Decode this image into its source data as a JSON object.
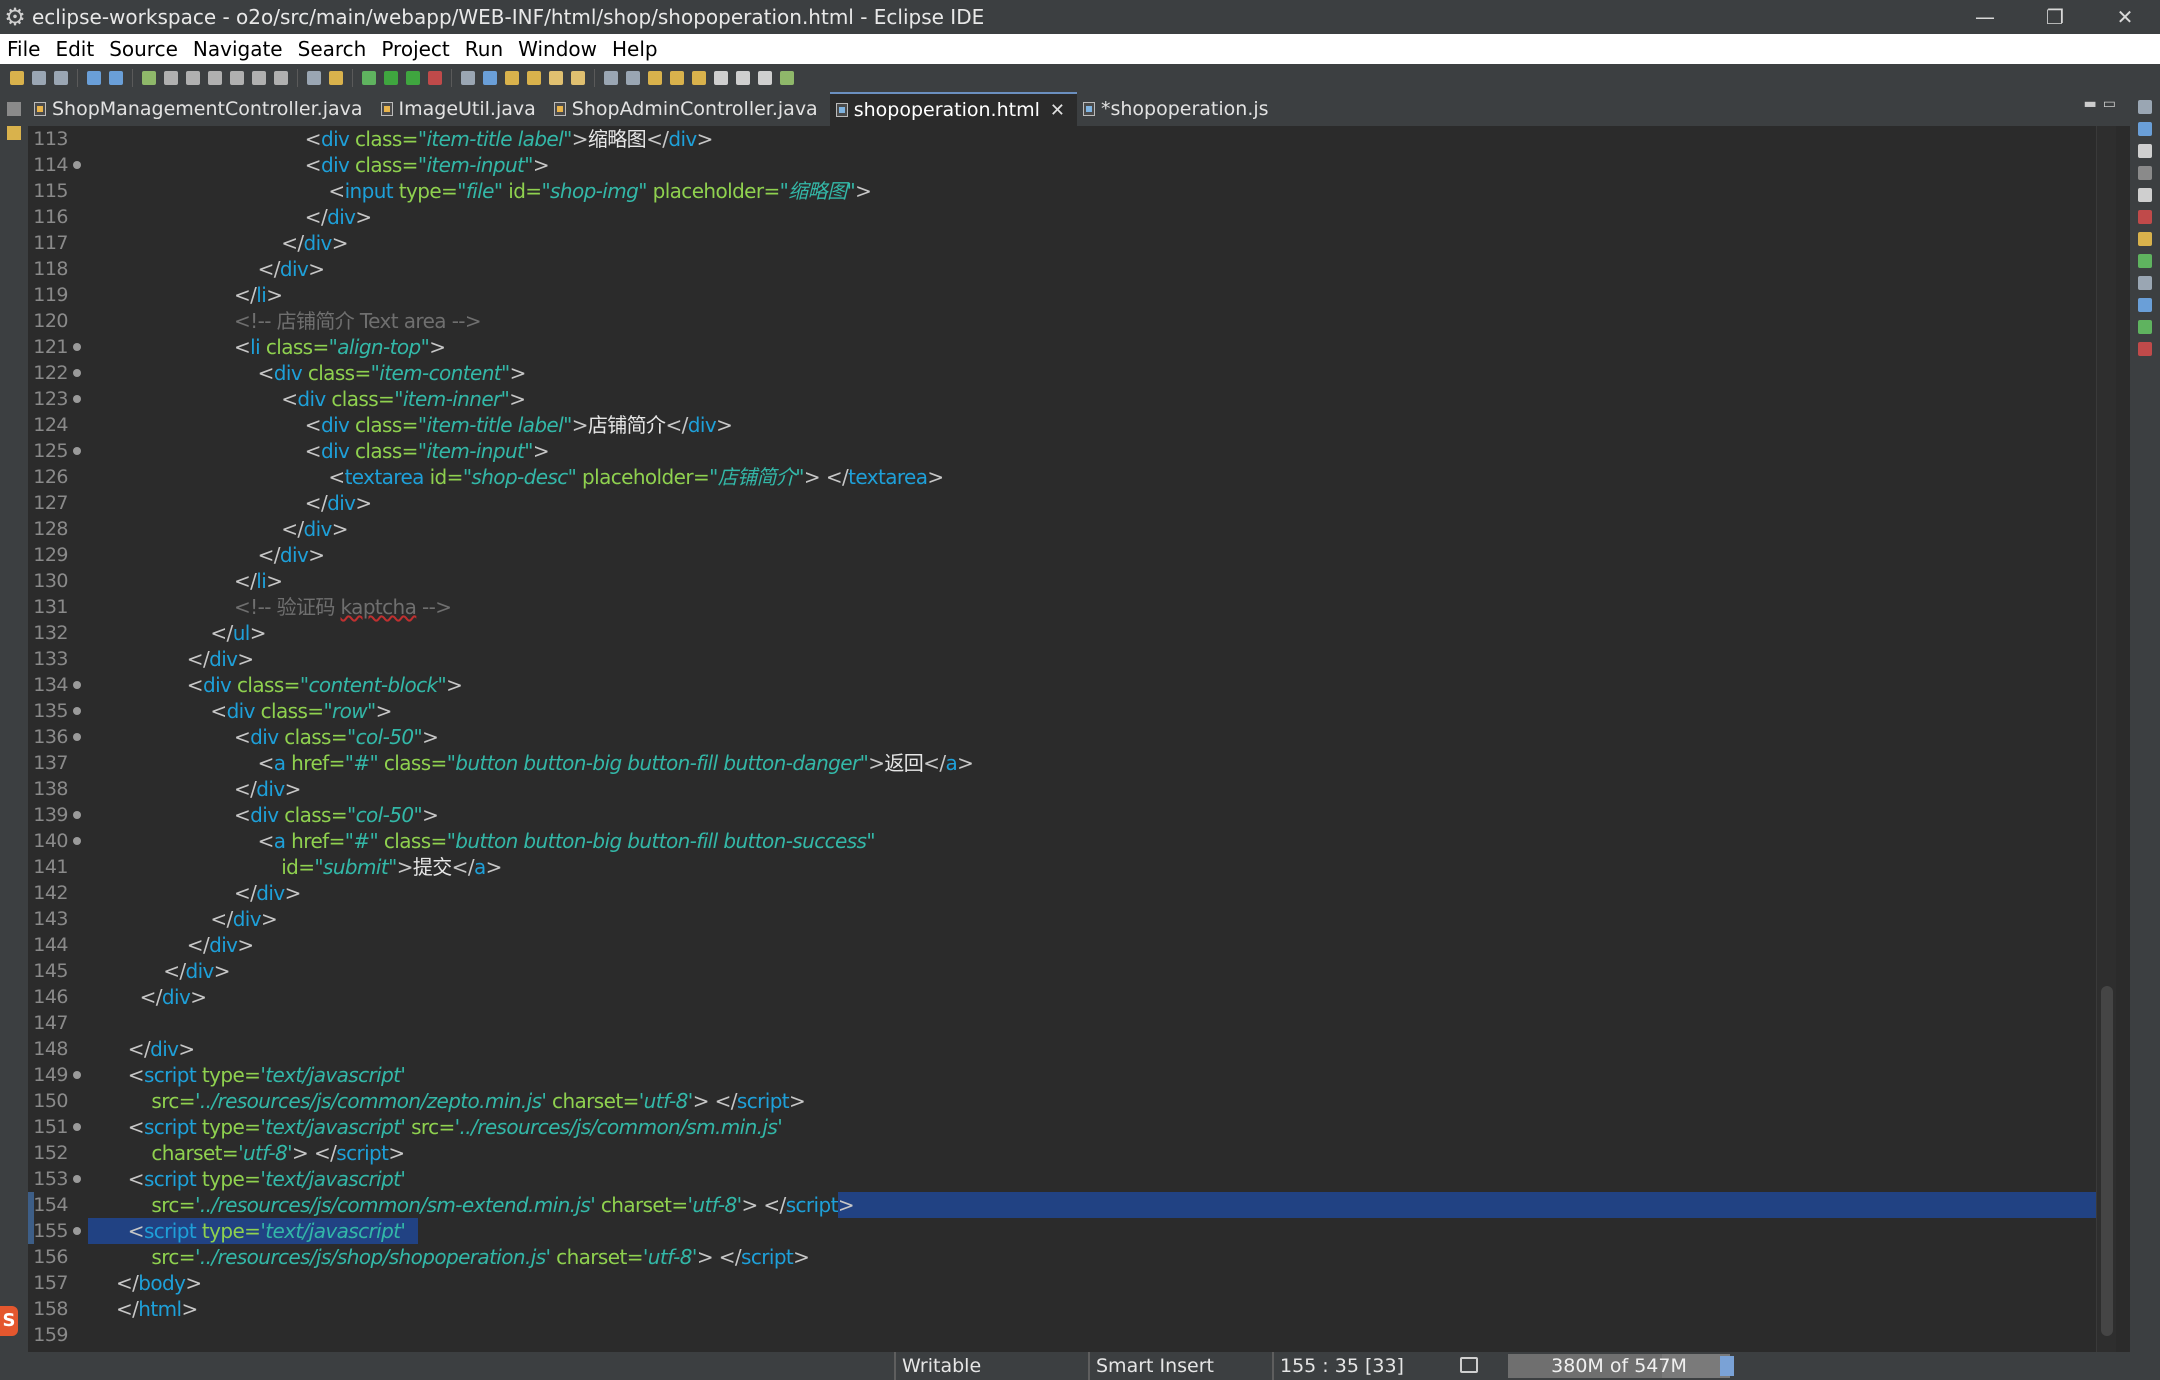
{
  "window": {
    "title": "eclipse-workspace - o2o/src/main/webapp/WEB-INF/html/shop/shopoperation.html - Eclipse IDE",
    "controls": {
      "minimize": "—",
      "restore": "❐",
      "close": "✕"
    }
  },
  "menu": [
    "File",
    "Edit",
    "Source",
    "Navigate",
    "Search",
    "Project",
    "Run",
    "Window",
    "Help"
  ],
  "tabs": [
    {
      "label": "ShopManagementController.java",
      "kind": "j",
      "active": false
    },
    {
      "label": "ImageUtil.java",
      "kind": "j",
      "active": false
    },
    {
      "label": "ShopAdminController.java",
      "kind": "j",
      "active": false
    },
    {
      "label": "shopoperation.html",
      "kind": "h",
      "active": true,
      "close": "✕"
    },
    {
      "label": "*shopoperation.js",
      "kind": "h",
      "active": false
    }
  ],
  "colors": {
    "selection": "#214283",
    "tag": "#1ea0d9",
    "attr": "#8fd14f",
    "value": "#33b8a8",
    "comment": "#6f6f6f"
  },
  "lines": [
    {
      "n": "113",
      "f": false,
      "i": 16,
      "t": [
        [
          "br",
          "<"
        ],
        [
          "tag",
          "div"
        ],
        [
          "at",
          " class="
        ],
        [
          "val",
          "\"item-title label\""
        ],
        [
          "br",
          ">"
        ],
        [
          "txt",
          "缩略图"
        ],
        [
          "br",
          "</"
        ],
        [
          "tag",
          "div"
        ],
        [
          "br",
          ">"
        ]
      ]
    },
    {
      "n": "114",
      "f": true,
      "i": 16,
      "t": [
        [
          "br",
          "<"
        ],
        [
          "tag",
          "div"
        ],
        [
          "at",
          " class="
        ],
        [
          "val",
          "\"item-input\""
        ],
        [
          "br",
          ">"
        ]
      ]
    },
    {
      "n": "115",
      "f": false,
      "i": 18,
      "t": [
        [
          "br",
          "<"
        ],
        [
          "tag",
          "input"
        ],
        [
          "at",
          " type="
        ],
        [
          "val",
          "\"file\""
        ],
        [
          "at",
          " id="
        ],
        [
          "val",
          "\"shop-img\""
        ],
        [
          "at",
          " placeholder="
        ],
        [
          "val",
          "\"缩略图\""
        ],
        [
          "br",
          ">"
        ]
      ]
    },
    {
      "n": "116",
      "f": false,
      "i": 16,
      "t": [
        [
          "br",
          "</"
        ],
        [
          "tag",
          "div"
        ],
        [
          "br",
          ">"
        ]
      ]
    },
    {
      "n": "117",
      "f": false,
      "i": 14,
      "t": [
        [
          "br",
          "</"
        ],
        [
          "tag",
          "div"
        ],
        [
          "br",
          ">"
        ]
      ]
    },
    {
      "n": "118",
      "f": false,
      "i": 12,
      "t": [
        [
          "br",
          "</"
        ],
        [
          "tag",
          "div"
        ],
        [
          "br",
          ">"
        ]
      ]
    },
    {
      "n": "119",
      "f": false,
      "i": 10,
      "t": [
        [
          "br",
          "</"
        ],
        [
          "tag",
          "li"
        ],
        [
          "br",
          ">"
        ]
      ]
    },
    {
      "n": "120",
      "f": false,
      "i": 10,
      "t": [
        [
          "cm",
          "<!-- 店铺简介 Text area -->"
        ]
      ]
    },
    {
      "n": "121",
      "f": true,
      "i": 10,
      "t": [
        [
          "br",
          "<"
        ],
        [
          "tag",
          "li"
        ],
        [
          "at",
          " class="
        ],
        [
          "val",
          "\"align-top\""
        ],
        [
          "br",
          ">"
        ]
      ]
    },
    {
      "n": "122",
      "f": true,
      "i": 12,
      "t": [
        [
          "br",
          "<"
        ],
        [
          "tag",
          "div"
        ],
        [
          "at",
          " class="
        ],
        [
          "val",
          "\"item-content\""
        ],
        [
          "br",
          ">"
        ]
      ]
    },
    {
      "n": "123",
      "f": true,
      "i": 14,
      "t": [
        [
          "br",
          "<"
        ],
        [
          "tag",
          "div"
        ],
        [
          "at",
          " class="
        ],
        [
          "val",
          "\"item-inner\""
        ],
        [
          "br",
          ">"
        ]
      ]
    },
    {
      "n": "124",
      "f": false,
      "i": 16,
      "t": [
        [
          "br",
          "<"
        ],
        [
          "tag",
          "div"
        ],
        [
          "at",
          " class="
        ],
        [
          "val",
          "\"item-title label\""
        ],
        [
          "br",
          ">"
        ],
        [
          "txt",
          "店铺简介"
        ],
        [
          "br",
          "</"
        ],
        [
          "tag",
          "div"
        ],
        [
          "br",
          ">"
        ]
      ]
    },
    {
      "n": "125",
      "f": true,
      "i": 16,
      "t": [
        [
          "br",
          "<"
        ],
        [
          "tag",
          "div"
        ],
        [
          "at",
          " class="
        ],
        [
          "val",
          "\"item-input\""
        ],
        [
          "br",
          ">"
        ]
      ]
    },
    {
      "n": "126",
      "f": false,
      "i": 18,
      "t": [
        [
          "br",
          "<"
        ],
        [
          "tag",
          "textarea"
        ],
        [
          "at",
          " id="
        ],
        [
          "val",
          "\"shop-desc\""
        ],
        [
          "at",
          " placeholder="
        ],
        [
          "val",
          "\"店铺简介\""
        ],
        [
          "br",
          "> </"
        ],
        [
          "tag",
          "textarea"
        ],
        [
          "br",
          ">"
        ]
      ]
    },
    {
      "n": "127",
      "f": false,
      "i": 16,
      "t": [
        [
          "br",
          "</"
        ],
        [
          "tag",
          "div"
        ],
        [
          "br",
          ">"
        ]
      ]
    },
    {
      "n": "128",
      "f": false,
      "i": 14,
      "t": [
        [
          "br",
          "</"
        ],
        [
          "tag",
          "div"
        ],
        [
          "br",
          ">"
        ]
      ]
    },
    {
      "n": "129",
      "f": false,
      "i": 12,
      "t": [
        [
          "br",
          "</"
        ],
        [
          "tag",
          "div"
        ],
        [
          "br",
          ">"
        ]
      ]
    },
    {
      "n": "130",
      "f": false,
      "i": 10,
      "t": [
        [
          "br",
          "</"
        ],
        [
          "tag",
          "li"
        ],
        [
          "br",
          ">"
        ]
      ]
    },
    {
      "n": "131",
      "f": false,
      "i": 10,
      "t": [
        [
          "cm",
          "<!-- 验证码 "
        ],
        [
          "cmu",
          "kaptcha"
        ],
        [
          "cm",
          " -->"
        ]
      ]
    },
    {
      "n": "132",
      "f": false,
      "i": 8,
      "t": [
        [
          "br",
          "</"
        ],
        [
          "tag",
          "ul"
        ],
        [
          "br",
          ">"
        ]
      ]
    },
    {
      "n": "133",
      "f": false,
      "i": 6,
      "t": [
        [
          "br",
          "</"
        ],
        [
          "tag",
          "div"
        ],
        [
          "br",
          ">"
        ]
      ]
    },
    {
      "n": "134",
      "f": true,
      "i": 6,
      "t": [
        [
          "br",
          "<"
        ],
        [
          "tag",
          "div"
        ],
        [
          "at",
          " class="
        ],
        [
          "val",
          "\"content-block\""
        ],
        [
          "br",
          ">"
        ]
      ]
    },
    {
      "n": "135",
      "f": true,
      "i": 8,
      "t": [
        [
          "br",
          "<"
        ],
        [
          "tag",
          "div"
        ],
        [
          "at",
          " class="
        ],
        [
          "val",
          "\"row\""
        ],
        [
          "br",
          ">"
        ]
      ]
    },
    {
      "n": "136",
      "f": true,
      "i": 10,
      "t": [
        [
          "br",
          "<"
        ],
        [
          "tag",
          "div"
        ],
        [
          "at",
          " class="
        ],
        [
          "val",
          "\"col-50\""
        ],
        [
          "br",
          ">"
        ]
      ]
    },
    {
      "n": "137",
      "f": false,
      "i": 12,
      "t": [
        [
          "br",
          "<"
        ],
        [
          "tag",
          "a"
        ],
        [
          "at",
          " href="
        ],
        [
          "val",
          "\"#\""
        ],
        [
          "at",
          " class="
        ],
        [
          "val",
          "\"button button-big button-fill button-danger\""
        ],
        [
          "br",
          ">"
        ],
        [
          "txt",
          "返回"
        ],
        [
          "br",
          "</"
        ],
        [
          "tag",
          "a"
        ],
        [
          "br",
          ">"
        ]
      ]
    },
    {
      "n": "138",
      "f": false,
      "i": 10,
      "t": [
        [
          "br",
          "</"
        ],
        [
          "tag",
          "div"
        ],
        [
          "br",
          ">"
        ]
      ]
    },
    {
      "n": "139",
      "f": true,
      "i": 10,
      "t": [
        [
          "br",
          "<"
        ],
        [
          "tag",
          "div"
        ],
        [
          "at",
          " class="
        ],
        [
          "val",
          "\"col-50\""
        ],
        [
          "br",
          ">"
        ]
      ]
    },
    {
      "n": "140",
      "f": true,
      "i": 12,
      "t": [
        [
          "br",
          "<"
        ],
        [
          "tag",
          "a"
        ],
        [
          "at",
          " href="
        ],
        [
          "val",
          "\"#\""
        ],
        [
          "at",
          " class="
        ],
        [
          "val",
          "\"button button-big button-fill button-success\""
        ]
      ]
    },
    {
      "n": "141",
      "f": false,
      "i": 14,
      "t": [
        [
          "at",
          "id="
        ],
        [
          "val",
          "\"submit\""
        ],
        [
          "br",
          ">"
        ],
        [
          "txt",
          "提交"
        ],
        [
          "br",
          "</"
        ],
        [
          "tag",
          "a"
        ],
        [
          "br",
          ">"
        ]
      ]
    },
    {
      "n": "142",
      "f": false,
      "i": 10,
      "t": [
        [
          "br",
          "</"
        ],
        [
          "tag",
          "div"
        ],
        [
          "br",
          ">"
        ]
      ]
    },
    {
      "n": "143",
      "f": false,
      "i": 8,
      "t": [
        [
          "br",
          "</"
        ],
        [
          "tag",
          "div"
        ],
        [
          "br",
          ">"
        ]
      ]
    },
    {
      "n": "144",
      "f": false,
      "i": 6,
      "t": [
        [
          "br",
          "</"
        ],
        [
          "tag",
          "div"
        ],
        [
          "br",
          ">"
        ]
      ]
    },
    {
      "n": "145",
      "f": false,
      "i": 4,
      "t": [
        [
          "br",
          "</"
        ],
        [
          "tag",
          "div"
        ],
        [
          "br",
          ">"
        ]
      ]
    },
    {
      "n": "146",
      "f": false,
      "i": 2,
      "t": [
        [
          "br",
          "</"
        ],
        [
          "tag",
          "div"
        ],
        [
          "br",
          ">"
        ]
      ]
    },
    {
      "n": "147",
      "f": false,
      "i": 0,
      "t": []
    },
    {
      "n": "148",
      "f": false,
      "i": 1,
      "t": [
        [
          "br",
          "</"
        ],
        [
          "tag",
          "div"
        ],
        [
          "br",
          ">"
        ]
      ]
    },
    {
      "n": "149",
      "f": true,
      "i": 1,
      "t": [
        [
          "br",
          "<"
        ],
        [
          "tag",
          "script"
        ],
        [
          "at",
          " type="
        ],
        [
          "val",
          "'text/javascript'"
        ]
      ]
    },
    {
      "n": "150",
      "f": false,
      "i": 3,
      "t": [
        [
          "at",
          "src="
        ],
        [
          "val",
          "'../resources/js/common/zepto.min.js'"
        ],
        [
          "at",
          " charset="
        ],
        [
          "val",
          "'utf-8'"
        ],
        [
          "br",
          "> </"
        ],
        [
          "tag",
          "script"
        ],
        [
          "br",
          ">"
        ]
      ]
    },
    {
      "n": "151",
      "f": true,
      "i": 1,
      "t": [
        [
          "br",
          "<"
        ],
        [
          "tag",
          "script"
        ],
        [
          "at",
          " type="
        ],
        [
          "val",
          "'text/javascript'"
        ],
        [
          "at",
          " src="
        ],
        [
          "val",
          "'../resources/js/common/sm.min.js'"
        ]
      ]
    },
    {
      "n": "152",
      "f": false,
      "i": 3,
      "t": [
        [
          "at",
          "charset="
        ],
        [
          "val",
          "'utf-8'"
        ],
        [
          "br",
          "> </"
        ],
        [
          "tag",
          "script"
        ],
        [
          "br",
          ">"
        ]
      ]
    },
    {
      "n": "153",
      "f": true,
      "i": 1,
      "t": [
        [
          "br",
          "<"
        ],
        [
          "tag",
          "script"
        ],
        [
          "at",
          " type="
        ],
        [
          "val",
          "'text/javascript'"
        ]
      ]
    },
    {
      "n": "154",
      "f": false,
      "i": 3,
      "t": [
        [
          "at",
          "src="
        ],
        [
          "val",
          "'../resources/js/common/sm-extend.min.js'"
        ],
        [
          "at",
          " charset="
        ],
        [
          "val",
          "'utf-8'"
        ],
        [
          "br",
          "> </"
        ],
        [
          "tag",
          "script"
        ],
        [
          "br",
          ">"
        ]
      ]
    },
    {
      "n": "155",
      "f": true,
      "i": 1,
      "t": [
        [
          "br",
          "<"
        ],
        [
          "tag",
          "script"
        ],
        [
          "at",
          " type="
        ],
        [
          "val",
          "'text/javascript'"
        ]
      ]
    },
    {
      "n": "156",
      "f": false,
      "i": 3,
      "t": [
        [
          "at",
          "src="
        ],
        [
          "val",
          "'../resources/js/shop/shopoperation.js'"
        ],
        [
          "at",
          " charset="
        ],
        [
          "val",
          "'utf-8'"
        ],
        [
          "br",
          "> </"
        ],
        [
          "tag",
          "script"
        ],
        [
          "br",
          ">"
        ]
      ]
    },
    {
      "n": "157",
      "f": false,
      "i": 0,
      "t": [
        [
          "br",
          "</"
        ],
        [
          "tag",
          "body"
        ],
        [
          "br",
          ">"
        ]
      ]
    },
    {
      "n": "158",
      "f": false,
      "i": 0,
      "t": [
        [
          "br",
          "</"
        ],
        [
          "tag",
          "html"
        ],
        [
          "br",
          ">"
        ]
      ]
    },
    {
      "n": "159",
      "f": false,
      "i": 0,
      "t": []
    }
  ],
  "status": {
    "writable": "Writable",
    "insert_mode": "Smart Insert",
    "position": "155 : 35 [33]",
    "heap": "380M of 547M"
  },
  "heap_used_fraction": 0.695
}
